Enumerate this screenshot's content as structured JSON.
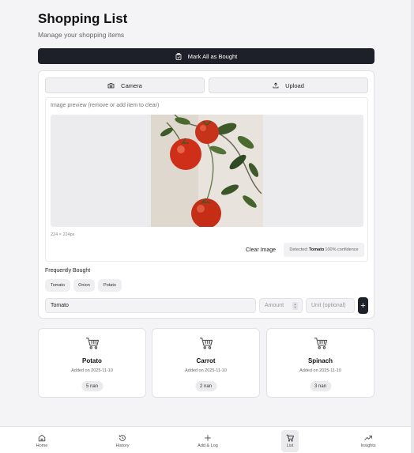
{
  "header": {
    "title": "Shopping List",
    "subtitle": "Manage your shopping items"
  },
  "actions": {
    "mark_all_label": "Mark All as Bought"
  },
  "capture": {
    "camera_label": "Camera",
    "upload_label": "Upload",
    "preview_label": "Image preview (remove or add item to clear)",
    "dimensions": "224 × 224px",
    "clear_label": "Clear Image",
    "detected_prefix": "Detected:",
    "detected_item": "Tomato",
    "detected_confidence": "100% confidence"
  },
  "frequent": {
    "label": "Frequently Bought",
    "chips": [
      "Tomato",
      "Onion",
      "Potato"
    ]
  },
  "add_form": {
    "item_value": "Tomato",
    "amount_placeholder": "Amount",
    "unit_placeholder": "Unit (optional)",
    "add_label": "+"
  },
  "items": [
    {
      "name": "Potato",
      "date": "Added on 2025-11-10",
      "qty": "5 nan"
    },
    {
      "name": "Carrot",
      "date": "Added on 2025-11-10",
      "qty": "2 nan"
    },
    {
      "name": "Spinach",
      "date": "Added on 2025-11-10",
      "qty": "3 nan"
    }
  ],
  "nav": [
    {
      "label": "Home",
      "icon": "home-icon"
    },
    {
      "label": "History",
      "icon": "history-icon"
    },
    {
      "label": "Add & Log",
      "icon": "plus-icon"
    },
    {
      "label": "List",
      "icon": "cart-icon",
      "active": true
    },
    {
      "label": "Insights",
      "icon": "trending-up-icon"
    }
  ],
  "colors": {
    "accent": "#1e2029",
    "background": "#f4f4f6",
    "tomato": "#d63a1f"
  }
}
